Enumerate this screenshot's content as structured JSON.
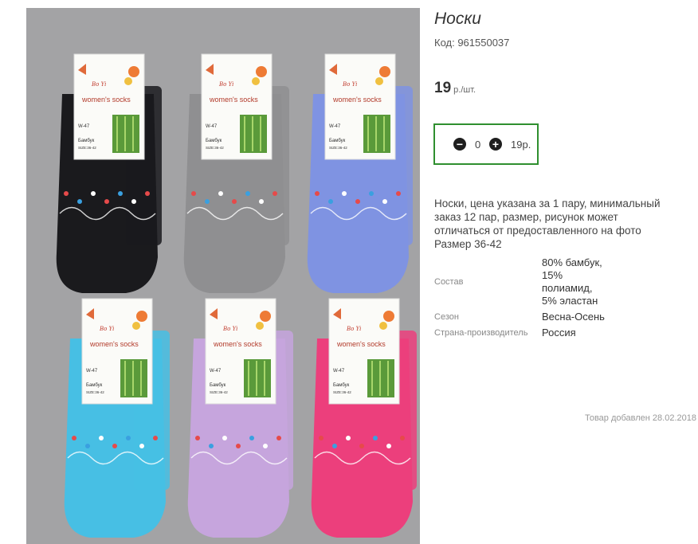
{
  "product": {
    "title": "Носки",
    "code_label": "Код: 961550037",
    "price_value": "19",
    "price_unit": "р./шт."
  },
  "quantity": {
    "value": "0",
    "sum": "19р."
  },
  "description": "Носки, цена указана за 1 пару, минимальный заказ 12 пар, размер, рисунок может отличаться от предоставленного на фото Размер 36-42",
  "properties": [
    {
      "label": "Состав",
      "value": "80% бамбук, 15% полиамид, 5% эластан"
    },
    {
      "label": "Сезон",
      "value": "Весна-Осень"
    },
    {
      "label": "Страна-производитель",
      "value": "Россия"
    }
  ],
  "added_date": "Товар добавлен 28.02.2018",
  "photo": {
    "tag_brand": "Bo Yi",
    "tag_title": "women's socks",
    "tag_model": "W-47",
    "tag_material": "Бамбук",
    "tag_size": "SIZE:36-42",
    "sock_colors": [
      "#1a1a1d",
      "#8f8f91",
      "#7f93e2",
      "#47bfe4",
      "#c6a5dd",
      "#ec3f7c"
    ],
    "pattern_colors": [
      "#e64a4a",
      "#3aa0e0",
      "#ffffff"
    ]
  }
}
